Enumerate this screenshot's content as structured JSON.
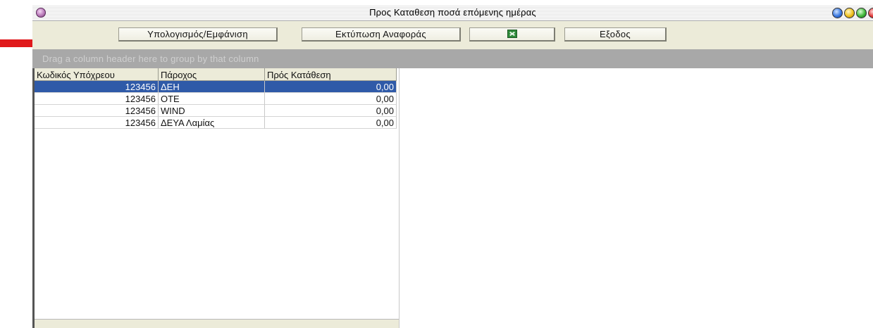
{
  "window": {
    "title": "Προς Καταθεση ποσά επόμενης ημέρας"
  },
  "toolbar": {
    "calc_label": "Υπολογισμός/Εμφάνιση",
    "print_label": "Εκτύπωση Αναφοράς",
    "excel_icon": "excel-icon",
    "exit_label": "Εξοδος"
  },
  "group_panel": {
    "hint": "Drag a column header here to group by that column"
  },
  "grid": {
    "columns": [
      "Κωδικός Υπόχρεου",
      "Πάροχος",
      "Πρός Κατάθεση"
    ],
    "rows": [
      {
        "code": "123456",
        "provider": "ΔΕΗ",
        "amount": "0,00",
        "selected": true
      },
      {
        "code": "123456",
        "provider": "ΟΤΕ",
        "amount": "0,00",
        "selected": false
      },
      {
        "code": "123456",
        "provider": "WIND",
        "amount": "0,00",
        "selected": false
      },
      {
        "code": "123456",
        "provider": "ΔΕΥΑ Λαμίας",
        "amount": "0,00",
        "selected": false
      }
    ]
  },
  "colors": {
    "selection": "#2f5aa8",
    "annotation_arrow": "#e0191b",
    "toolbar_bg": "#ecebd9",
    "group_panel_bg": "#a8a8a8"
  }
}
